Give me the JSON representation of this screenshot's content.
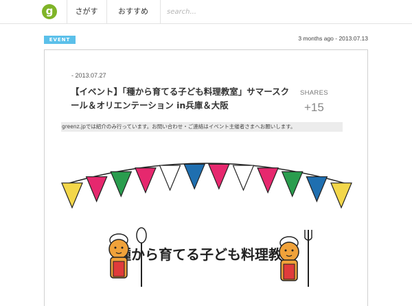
{
  "nav": {
    "logo_glyph": "g",
    "items": [
      {
        "label": "さがす"
      },
      {
        "label": "おすすめ"
      }
    ],
    "search_placeholder": "search..."
  },
  "meta": {
    "badge": "EVENT",
    "posted": "3 months ago - 2013.07.13"
  },
  "article": {
    "date": "- 2013.07.27",
    "title": "【イベント】「種から育てる子ども料理教室」サマースクール＆オリエンテーション in兵庫＆大阪",
    "shares_label": "SHARES",
    "shares_count": "+15",
    "notice": "greenz.jpでは紹介のみ行っています。お問い合わせ・ご連絡はイベント主催者さまへお願いします。"
  },
  "illustration": {
    "logo_text": "種から育てる子ども料理教室",
    "flag_colors": [
      "#f3d74a",
      "#e6286e",
      "#2a9d4e",
      "#e6286e",
      "#ffffff",
      "#1f6fb0",
      "#e6286e",
      "#ffffff",
      "#e6286e",
      "#2a9d4e",
      "#1f6fb0",
      "#f3d74a"
    ]
  }
}
